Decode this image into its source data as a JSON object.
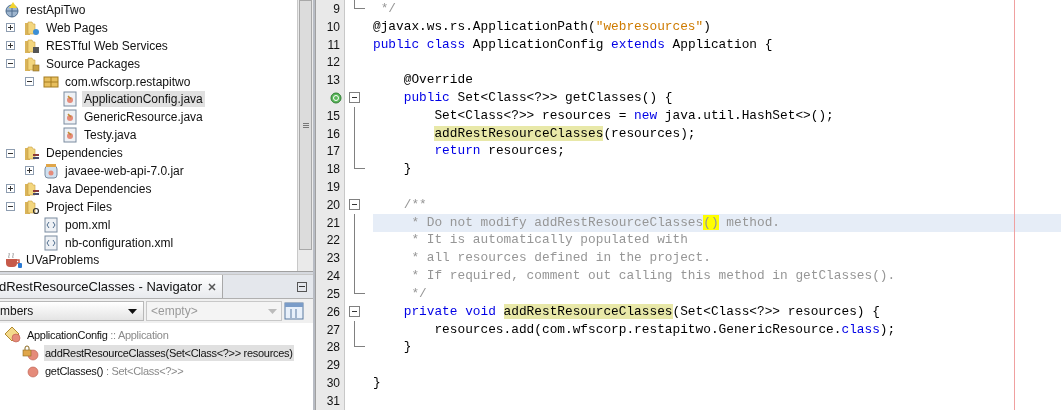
{
  "project_tree": {
    "items": [
      {
        "label": "restApiTwo",
        "kind": "project",
        "selected": false,
        "children": [
          {
            "label": "Web Pages",
            "kind": "web-folder",
            "expanded": false,
            "selected": false
          },
          {
            "label": "RESTful Web Services",
            "kind": "rest-folder",
            "expanded": false,
            "selected": false
          },
          {
            "label": "Source Packages",
            "kind": "source-folder",
            "expanded": true,
            "selected": false,
            "children": [
              {
                "label": "com.wfscorp.restapitwo",
                "kind": "package",
                "expanded": true,
                "selected": false,
                "children": [
                  {
                    "label": "ApplicationConfig.java",
                    "kind": "java",
                    "selected": true
                  },
                  {
                    "label": "GenericResource.java",
                    "kind": "java",
                    "selected": false
                  },
                  {
                    "label": "Testy.java",
                    "kind": "java",
                    "selected": false
                  }
                ]
              }
            ]
          },
          {
            "label": "Dependencies",
            "kind": "lib-folder",
            "expanded": true,
            "selected": false,
            "children": [
              {
                "label": "javaee-web-api-7.0.jar",
                "kind": "jar",
                "expanded": false,
                "selected": false
              }
            ]
          },
          {
            "label": "Java Dependencies",
            "kind": "lib-folder",
            "expanded": false,
            "selected": false
          },
          {
            "label": "Project Files",
            "kind": "config-folder",
            "expanded": true,
            "selected": false,
            "children": [
              {
                "label": "pom.xml",
                "kind": "xml",
                "selected": false
              },
              {
                "label": "nb-configuration.xml",
                "kind": "xml",
                "selected": false
              }
            ]
          }
        ]
      },
      {
        "label": "UVaProblems",
        "kind": "coffee-project",
        "selected": false
      }
    ]
  },
  "navigator": {
    "title": "dRestResourceClasses - Navigator",
    "view_select": "mbers",
    "filter_select": {
      "value": "<empty>",
      "disabled": true
    },
    "members": [
      {
        "name": "ApplicationConfig",
        "type": ":: Application",
        "kind": "class",
        "selected": false,
        "children": [
          {
            "name": "addRestResourceClasses(Set<Class<?>> resources)",
            "kind": "private-method",
            "selected": true
          },
          {
            "name": "getClasses()",
            "type": ": Set<Class<?>>",
            "kind": "method",
            "selected": false
          }
        ]
      }
    ]
  },
  "editor": {
    "lines": [
      {
        "number": "9",
        "current": false,
        "fold_end": true,
        "tokens": [
          {
            "text": " */",
            "kind": "comment"
          }
        ]
      },
      {
        "number": "10",
        "current": false,
        "tokens": [
          {
            "text": "@javax.ws.rs.ApplicationPath(",
            "kind": "plain"
          },
          {
            "text": "\"webresources\"",
            "kind": "string"
          },
          {
            "text": ")",
            "kind": "plain"
          }
        ]
      },
      {
        "number": "11",
        "current": false,
        "tokens": [
          {
            "text": "public class",
            "kind": "keyword"
          },
          {
            "text": " ApplicationConfig ",
            "kind": "plain"
          },
          {
            "text": "extends",
            "kind": "keyword"
          },
          {
            "text": " Application {",
            "kind": "plain"
          }
        ]
      },
      {
        "number": "12",
        "current": false
      },
      {
        "number": "13",
        "current": false,
        "tokens": [
          {
            "text": "    @Override",
            "kind": "plain"
          }
        ]
      },
      {
        "override": true,
        "current": false,
        "fold_expanded": true,
        "tokens": [
          {
            "text": "    public",
            "kind": "keyword"
          },
          {
            "text": " Set<Class<?>> getClasses() {",
            "kind": "plain"
          }
        ]
      },
      {
        "number": "15",
        "current": false,
        "fold_guide": true,
        "tokens": [
          {
            "text": "        Set<Class<?>> resources = ",
            "kind": "plain"
          },
          {
            "text": "new",
            "kind": "keyword"
          },
          {
            "text": " java.util.HashSet<>();",
            "kind": "plain"
          }
        ]
      },
      {
        "number": "16",
        "current": false,
        "fold_guide": true,
        "tokens": [
          {
            "text": "        addRestResourceClasses",
            "kind": "highlight"
          },
          {
            "text": "(resources);",
            "kind": "plain"
          }
        ]
      },
      {
        "number": "17",
        "current": false,
        "fold_guide": true,
        "tokens": [
          {
            "text": "        return",
            "kind": "keyword"
          },
          {
            "text": " resources;",
            "kind": "plain"
          }
        ]
      },
      {
        "number": "18",
        "current": false,
        "fold_end": true,
        "tokens": [
          {
            "text": "    }",
            "kind": "plain"
          }
        ]
      },
      {
        "number": "19",
        "current": false
      },
      {
        "number": "20",
        "current": false,
        "fold_expanded": true,
        "tokens": [
          {
            "text": "    /**",
            "kind": "comment"
          }
        ]
      },
      {
        "number": "21",
        "current": true,
        "fold_guide": true,
        "tokens": [
          {
            "text": "     * Do not modify addRestResourceClasses",
            "kind": "comment"
          },
          {
            "text": "()",
            "kind": "match"
          },
          {
            "text": " method.",
            "kind": "comment"
          }
        ]
      },
      {
        "number": "22",
        "current": false,
        "fold_guide": true,
        "tokens": [
          {
            "text": "     * It is automatically populated with",
            "kind": "comment"
          }
        ]
      },
      {
        "number": "23",
        "current": false,
        "fold_guide": true,
        "tokens": [
          {
            "text": "     * all resources defined in the project.",
            "kind": "comment"
          }
        ]
      },
      {
        "number": "24",
        "current": false,
        "fold_guide": true,
        "tokens": [
          {
            "text": "     * If required, comment out calling this method in getClasses().",
            "kind": "comment"
          }
        ]
      },
      {
        "number": "25",
        "current": false,
        "fold_end": true,
        "tokens": [
          {
            "text": "     */",
            "kind": "comment"
          }
        ]
      },
      {
        "number": "26",
        "current": false,
        "fold_expanded": true,
        "tokens": [
          {
            "text": "    private void",
            "kind": "keyword"
          },
          {
            "text": " addRestResourceClasses",
            "kind": "highlight"
          },
          {
            "text": "(Set<Class<?>> resources) {",
            "kind": "plain"
          }
        ]
      },
      {
        "number": "27",
        "current": false,
        "fold_guide": true,
        "tokens": [
          {
            "text": "        resources.add(com.wfscorp.restapitwo.GenericResource.",
            "kind": "plain"
          },
          {
            "text": "class",
            "kind": "keyword"
          },
          {
            "text": ");",
            "kind": "plain"
          }
        ]
      },
      {
        "number": "28",
        "current": false,
        "fold_end": true,
        "tokens": [
          {
            "text": "    }",
            "kind": "plain"
          }
        ]
      },
      {
        "number": "29",
        "current": false
      },
      {
        "number": "30",
        "current": false,
        "tokens": [
          {
            "text": "}",
            "kind": "plain"
          }
        ]
      },
      {
        "number": "31",
        "current": false
      }
    ]
  }
}
